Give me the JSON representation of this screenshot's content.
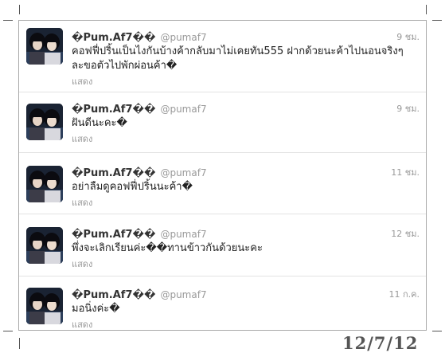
{
  "tweets": [
    {
      "name": "�Pum.Af7��",
      "handle": "@pumaf7",
      "time": "9 ชม.",
      "text": "คอฟฟี่ปริ้นเป็นไงกันบ้างค้ากลับมาไม่เคยทัน555 ฝากด้วยนะค้าไปนอนจริงๆละขอตัวไปพักผ่อนค้า�",
      "show": "แสดง"
    },
    {
      "name": "�Pum.Af7��",
      "handle": "@pumaf7",
      "time": "9 ชม.",
      "text": "ฝันดีนะคะ�",
      "show": "แสดง"
    },
    {
      "name": "�Pum.Af7��",
      "handle": "@pumaf7",
      "time": "11 ชม.",
      "text": "อย่าลืมดูคอฟฟี่ปริ้นนะค้า�",
      "show": "แสดง"
    },
    {
      "name": "�Pum.Af7��",
      "handle": "@pumaf7",
      "time": "12 ชม.",
      "text": "พึ่งจะเลิกเรียนค่ะ��ทานข้าวกันด้วยนะคะ",
      "show": "แสดง"
    },
    {
      "name": "�Pum.Af7��",
      "handle": "@pumaf7",
      "time": "11 ก.ค.",
      "text": "มอนิ่งค่ะ�",
      "show": "แสดง"
    }
  ],
  "date_stamp": "12/7/12",
  "colors": {
    "border": "#a9a9a9",
    "divider": "#e3e3e3",
    "name": "#333333",
    "meta": "#999999",
    "text": "#222222"
  },
  "icons": {
    "avatar": "profile-photo-avatar"
  }
}
